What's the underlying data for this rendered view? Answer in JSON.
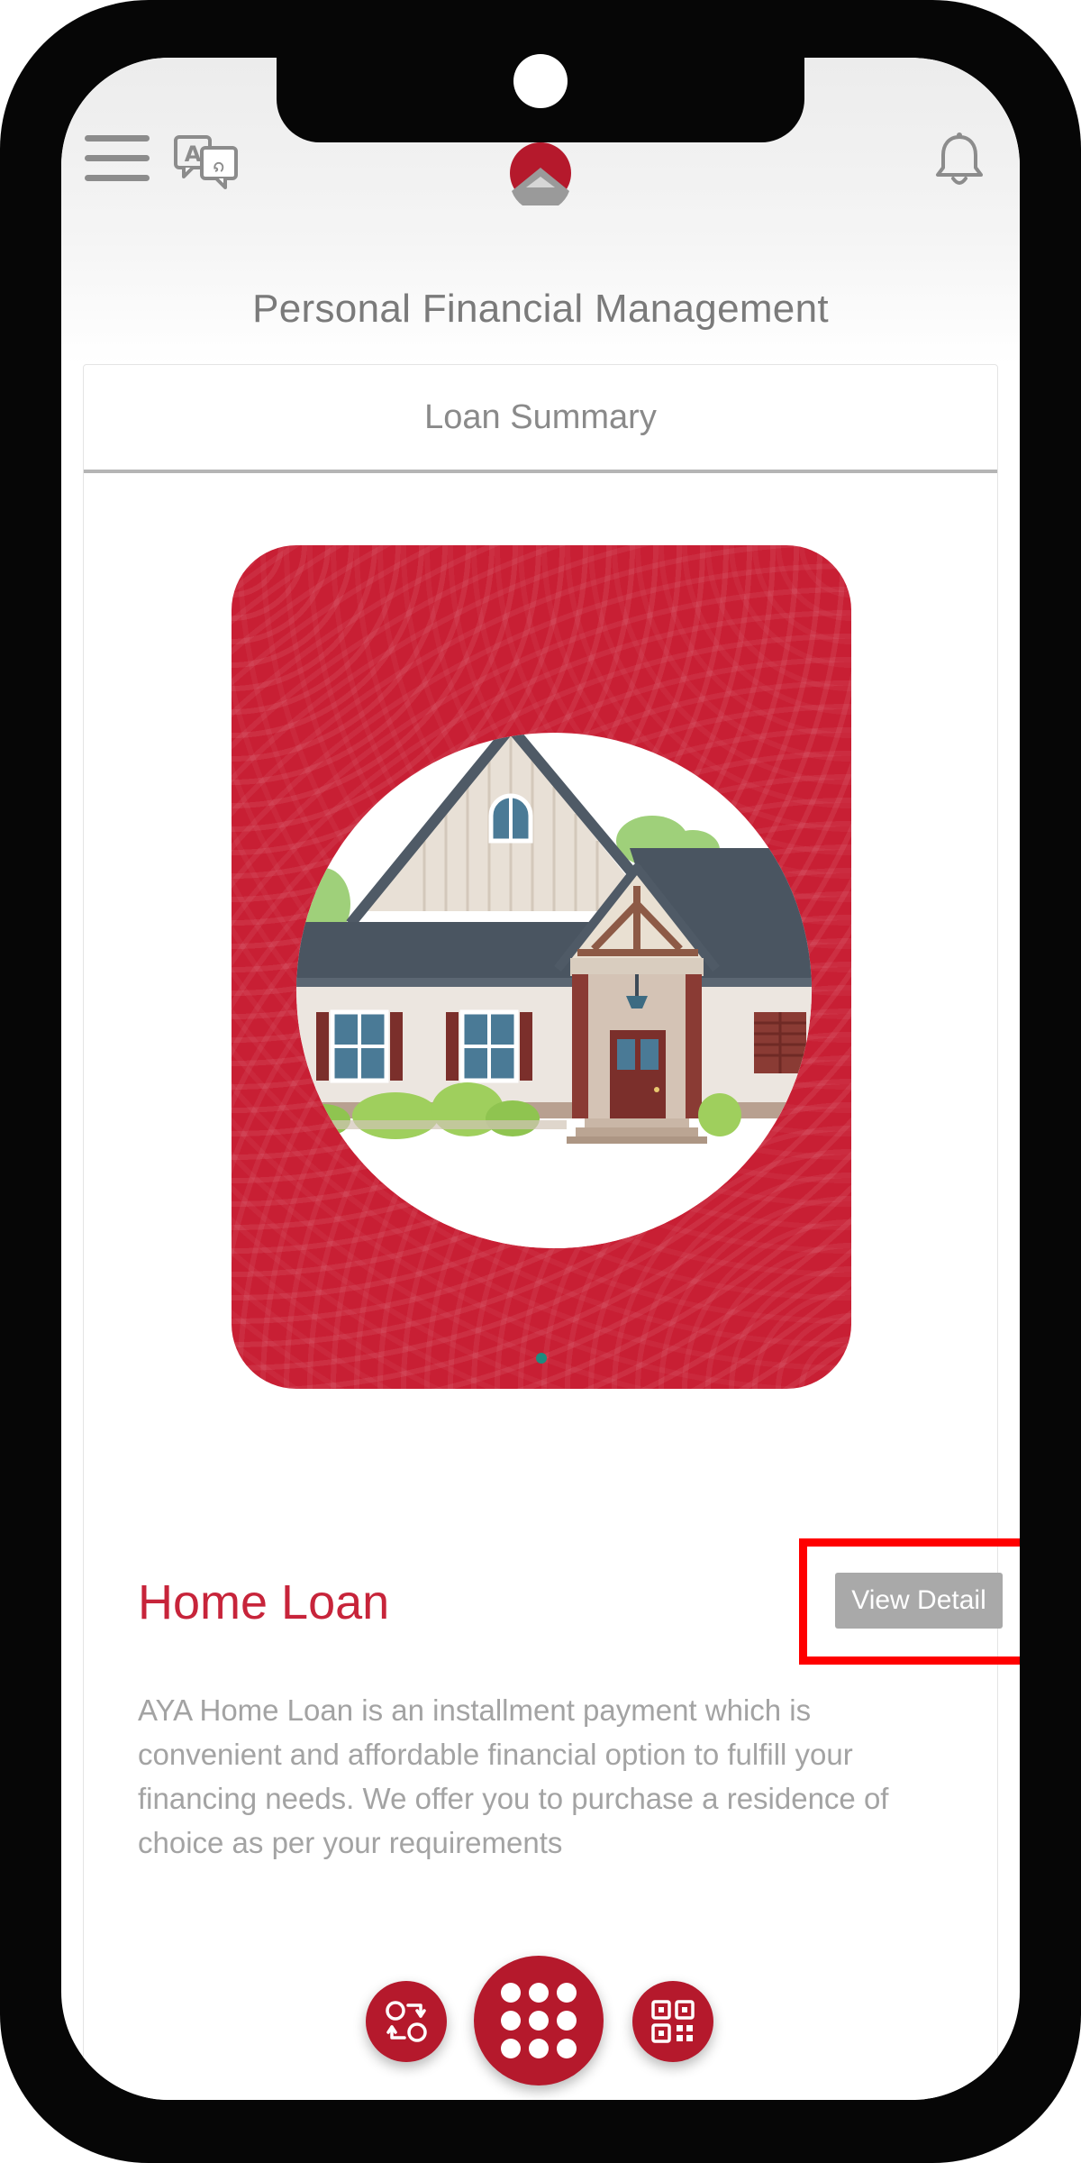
{
  "header": {
    "title": "Personal Financial Management",
    "subtitle_dots": "............."
  },
  "tabs": [
    {
      "label": "Loan Summary"
    }
  ],
  "loan": {
    "title": "Home Loan",
    "view_button_label": "View Detail",
    "description": "AYA Home Loan is an installment payment which is convenient and affordable financial option to fulfill your financing needs. We offer you to purchase a residence of choice as per your requirements"
  },
  "icons": {
    "menu": "hamburger-menu-icon",
    "language": "translate-icon",
    "logo": "brand-logo",
    "notifications": "bell-icon",
    "nav_left": "currency-exchange-icon",
    "nav_center": "apps-grid-icon",
    "nav_right": "qr-code-icon"
  },
  "colors": {
    "brand_red": "#c81f34",
    "title_red": "#c7243a",
    "highlight": "#ff0000",
    "button_gray": "#a9a9a9",
    "carousel_dot": "#1f8b7f"
  }
}
